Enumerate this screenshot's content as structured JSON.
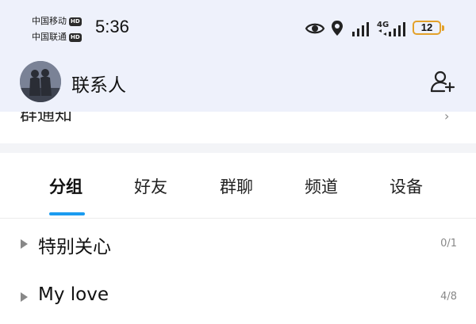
{
  "status_bar": {
    "carrier1": "中国移动",
    "carrier2": "中国联通",
    "hd_badge": "HD",
    "time": "5:36",
    "network": "4G",
    "battery": "12",
    "icons": [
      "eye-icon",
      "location-icon",
      "signal-icon",
      "4g-signal-icon",
      "battery-icon"
    ]
  },
  "header": {
    "title": "联系人",
    "avatar": "user-avatar",
    "add_contact_icon": "add-contact-icon"
  },
  "partial_row": {
    "label": "群通知",
    "icon": "chevron-right-icon"
  },
  "tabs": [
    {
      "label": "分组",
      "active": true
    },
    {
      "label": "好友",
      "active": false
    },
    {
      "label": "群聊",
      "active": false
    },
    {
      "label": "频道",
      "active": false
    },
    {
      "label": "设备",
      "active": false
    }
  ],
  "groups": [
    {
      "name": "特别关心",
      "count": "0/1"
    },
    {
      "name": "My love",
      "count": "4/8"
    }
  ],
  "colors": {
    "header_bg": "#eef1fb",
    "accent": "#1a9bf0",
    "battery_outline": "#e3a12a"
  }
}
